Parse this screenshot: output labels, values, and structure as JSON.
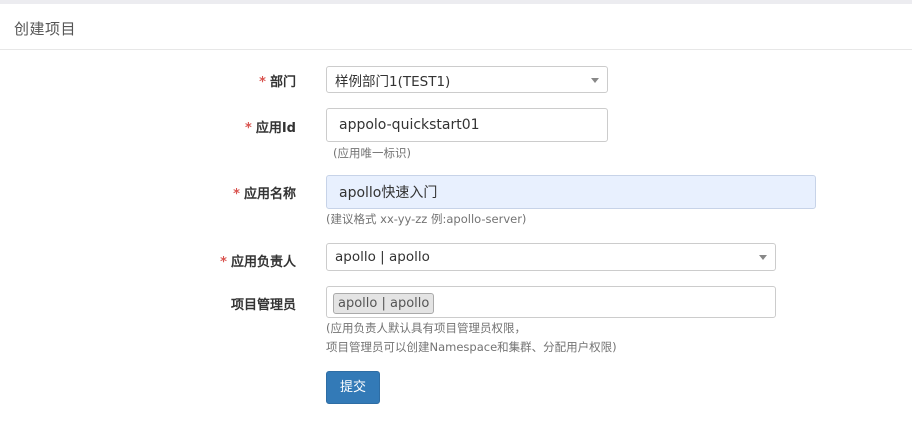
{
  "page": {
    "title": "创建项目"
  },
  "form": {
    "required_mark": "*",
    "department": {
      "label": "部门",
      "selected": "样例部门1(TEST1)"
    },
    "app_id": {
      "label": "应用Id",
      "value": "appolo-quickstart01",
      "help": "(应用唯一标识)"
    },
    "app_name": {
      "label": "应用名称",
      "value": "apollo快速入门",
      "help": "(建议格式 xx-yy-zz 例:apollo-server)"
    },
    "owner": {
      "label": "应用负责人",
      "selected": "apollo | apollo"
    },
    "admins": {
      "label": "项目管理员",
      "tags": [
        "apollo | apollo"
      ],
      "help_line1": "(应用负责人默认具有项目管理员权限，",
      "help_line2": "项目管理员可以创建Namespace和集群、分配用户权限)"
    },
    "submit_label": "提交"
  },
  "colors": {
    "primary_button": "#337ab7",
    "required_star": "#d9534f",
    "autofill_bg": "#e8f0fe"
  },
  "icons": {
    "dropdown": "chevron-down-icon"
  }
}
